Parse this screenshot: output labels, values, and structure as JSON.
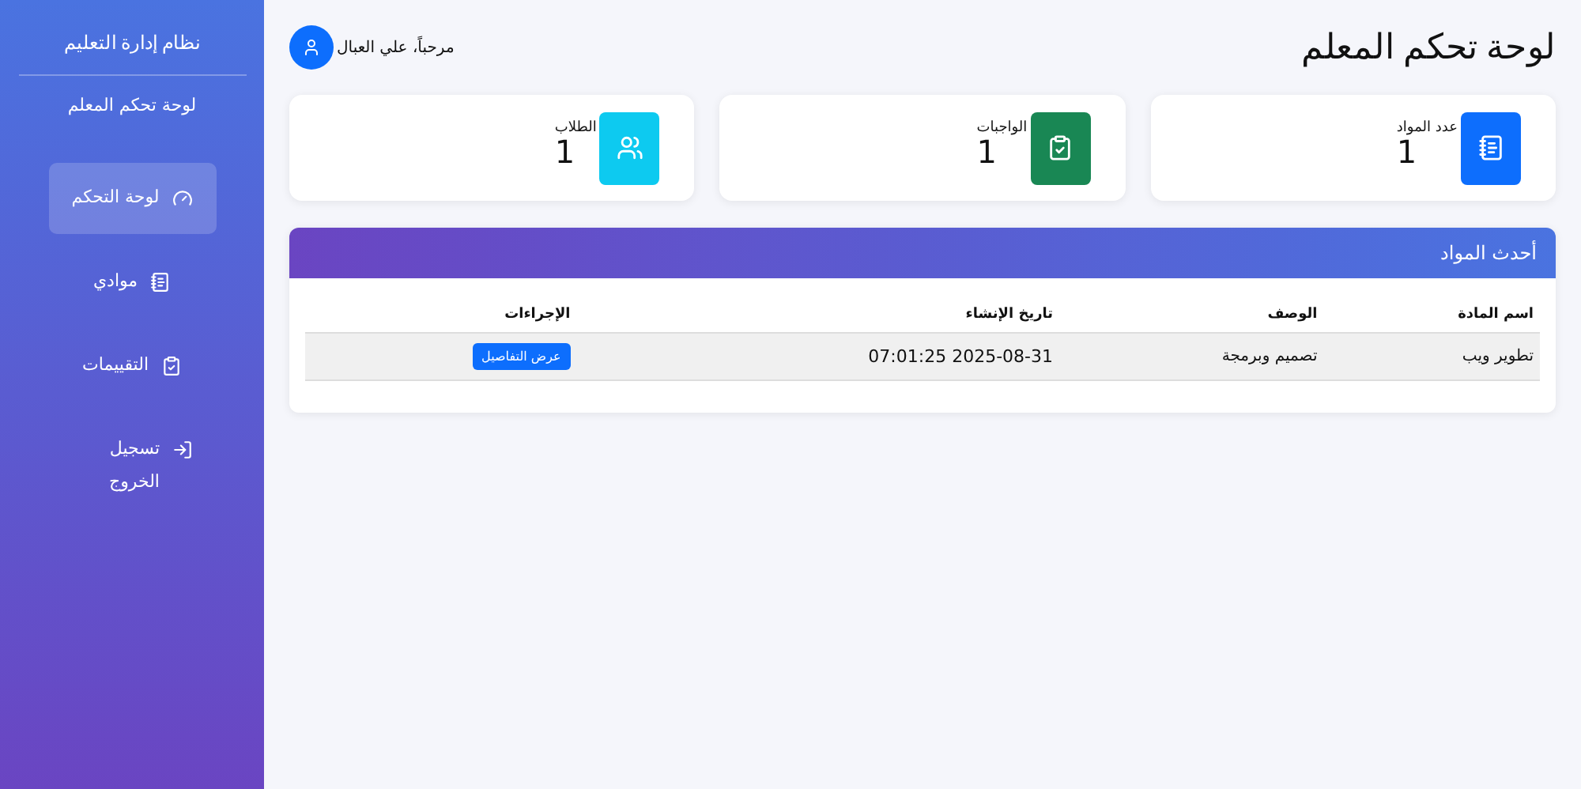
{
  "sidebar": {
    "title": "نظام إدارة التعليم",
    "subtitle": "لوحة تحكم المعلم",
    "items": [
      {
        "label": "لوحة التحكم",
        "selected": true
      },
      {
        "label": "موادي",
        "selected": false
      },
      {
        "label": "التقييمات",
        "selected": false
      },
      {
        "label": "تسجيل الخروج",
        "selected": false
      }
    ]
  },
  "header": {
    "title": "لوحة تحكم المعلم",
    "greeting": "مرحباً، علي العبال"
  },
  "stats": [
    {
      "label": "عدد المواد",
      "value": "1",
      "color": "#0d6efd"
    },
    {
      "label": "الواجبات",
      "value": "1",
      "color": "#198754"
    },
    {
      "label": "الطلاب",
      "value": "1",
      "color": "#0dcaf0"
    }
  ],
  "recent": {
    "title": "أحدث المواد",
    "columns": [
      "اسم المادة",
      "الوصف",
      "تاريخ الإنشاء",
      "الإجراءات"
    ],
    "rows": [
      {
        "cells": [
          "تطوير ويب",
          "تصميم وبرمجة",
          "2025-08-31 07:01:25"
        ],
        "action": "عرض التفاصيل"
      }
    ]
  }
}
